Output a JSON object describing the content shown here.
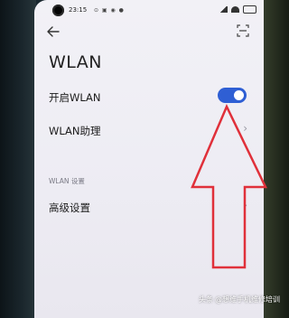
{
  "status_bar": {
    "time": "23:15",
    "left_icons": "⊙ ▣ ◉ ●",
    "right_icons": [
      "signal-icon",
      "wifi-icon",
      "battery-icon"
    ]
  },
  "header": {
    "back_icon": "back-arrow-icon",
    "scan_icon": "scan-icon",
    "title": "WLAN"
  },
  "settings": {
    "wlan_toggle": {
      "label": "开启WLAN",
      "enabled": true
    },
    "wlan_assistant": {
      "label": "WLAN助理",
      "chevron": "›"
    },
    "section_label": "WLAN 设置",
    "advanced": {
      "label": "高级设置",
      "chevron": "›"
    }
  },
  "overlay": {
    "arrow_color": "#e0303a"
  },
  "watermark": {
    "prefix": "头条",
    "text": "@想维手机维修培训"
  },
  "colors": {
    "accent": "#2f5fd4",
    "screen_bg": "#eeedf4",
    "text_primary": "#1c1c1c",
    "text_secondary": "#7a7a85"
  }
}
